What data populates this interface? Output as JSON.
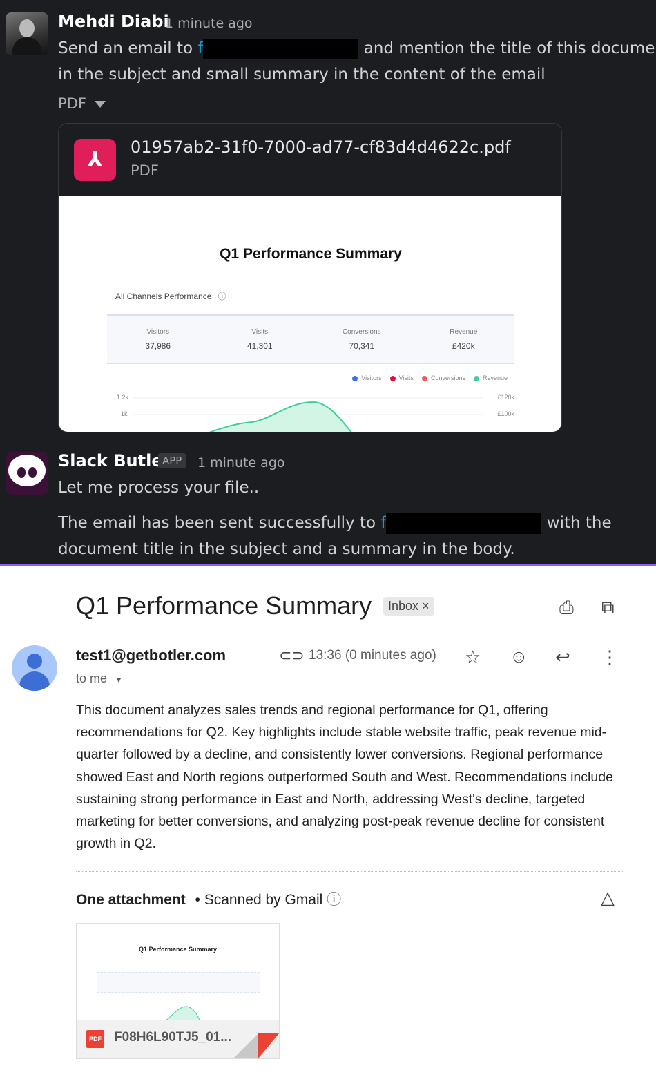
{
  "slack": {
    "message1": {
      "author": "Mehdi Diabi",
      "time": "1 minute ago",
      "line1_pre": "Send an email to ",
      "line1_link": "f",
      "line1_post": " and mention the title of this document",
      "line2": "in the subject and small summary in the content of the email",
      "file_toggle": "PDF",
      "file": {
        "name": "01957ab2-31f0-7000-ad77-cf83d4d4622c.pdf",
        "type": "PDF"
      }
    },
    "preview": {
      "title": "Q1 Performance Summary",
      "subtitle": "All Channels Performance",
      "stats": [
        {
          "label": "Visitors",
          "value": "37,986"
        },
        {
          "label": "Visits",
          "value": "41,301"
        },
        {
          "label": "Conversions",
          "value": "70,341"
        },
        {
          "label": "Revenue",
          "value": "£420k"
        }
      ],
      "legend": [
        {
          "name": "Visitors",
          "color": "#3b6ee8"
        },
        {
          "name": "Visits",
          "color": "#e0103c"
        },
        {
          "name": "Conversions",
          "color": "#ef5b63"
        },
        {
          "name": "Revenue",
          "color": "#3fcf9a"
        }
      ],
      "y_left": [
        "1.2k",
        "1k"
      ],
      "y_right": [
        "£120k",
        "£100k"
      ]
    },
    "message2": {
      "author": "Slack Butler",
      "badge": "APP",
      "time": "1 minute ago",
      "line1": "Let me process your file..",
      "line2_pre": "The email has been sent successfully to ",
      "line2_link": "f",
      "line2_post": " with the",
      "line3": "document title in the subject and a summary in the body."
    }
  },
  "gmail": {
    "subject": "Q1 Performance Summary",
    "label": "Inbox",
    "label_close": "×",
    "sender": "test1@getbotler.com",
    "time": "13:36 (0 minutes ago)",
    "recipient": "to me",
    "body": "This document analyzes sales trends and regional performance for Q1, offering recommendations for Q2. Key highlights include stable website traffic, peak revenue mid-quarter followed by a decline, and consistently lower conversions. Regional performance showed East and North regions outperformed South and West. Recommendations include sustaining strong performance in East and North, addressing West's decline, targeted marketing for better conversions, and analyzing post-peak revenue decline for consistent growth in Q2.",
    "attachments_title": "One attachment",
    "scanned": " • Scanned by Gmail",
    "attachment": {
      "name": "F08H6L90TJ5_01...",
      "icon": "PDF",
      "preview_title": "Q1 Performance Summary"
    }
  }
}
